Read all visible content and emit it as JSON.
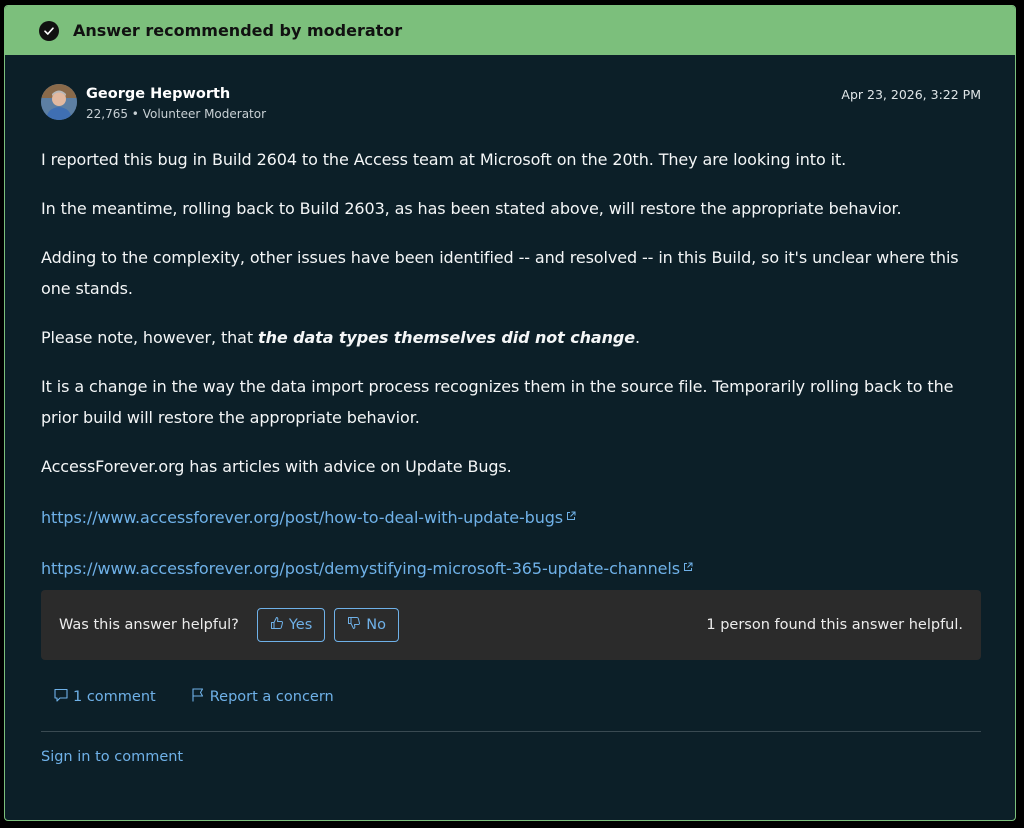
{
  "banner": {
    "label": "Answer recommended by moderator"
  },
  "author": {
    "name": "George Hepworth",
    "meta": "22,765 • Volunteer Moderator",
    "timestamp": "Apr 23, 2026, 3:22 PM"
  },
  "body": {
    "p1": "I reported this bug in Build 2604 to the Access team at Microsoft on the 20th. They are looking into it.",
    "p2": "In the meantime, rolling back to Build 2603, as has been stated above, will restore the appropriate behavior.",
    "p3": "Adding to the complexity, other issues have been identified -- and resolved -- in this Build, so it's unclear where this one stands.",
    "p4_prefix": "Please note, however, that ",
    "p4_emphasis": "the data types themselves did not change",
    "p4_suffix": ".",
    "p5": "It is a change in the way the data import process recognizes them in the source file. Temporarily rolling back to the prior build will restore the appropriate behavior.",
    "p6": "AccessForever.org has articles with advice on Update Bugs.",
    "link1": "https://www.accessforever.org/post/how-to-deal-with-update-bugs",
    "link2": "https://www.accessforever.org/post/demystifying-microsoft-365-update-channels"
  },
  "feedback": {
    "question": "Was this answer helpful?",
    "yes_label": "Yes",
    "no_label": "No",
    "count_text": "1 person found this answer helpful."
  },
  "actions": {
    "comment_label": "1 comment",
    "report_label": "Report a concern"
  },
  "signin_label": "Sign in to comment",
  "colors": {
    "banner_bg": "#7cbf7c",
    "card_bg": "#0c1f28",
    "link": "#6fb1e8",
    "feedback_bg": "#2b2b2b"
  }
}
